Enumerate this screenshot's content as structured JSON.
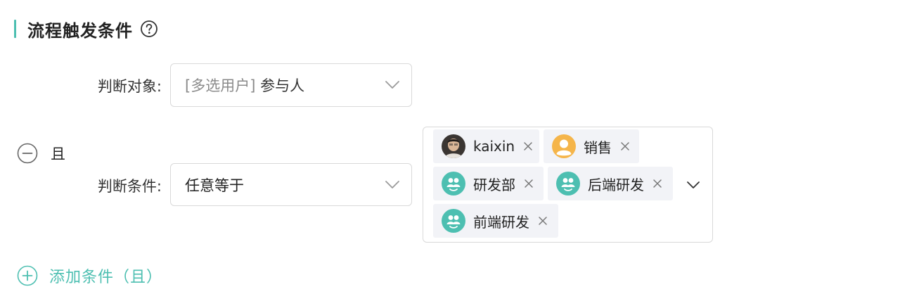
{
  "section": {
    "title": "流程触发条件"
  },
  "judge_object": {
    "label": "判断对象:",
    "value_prefix": "[多选用户]",
    "value_main": "参与人"
  },
  "group": {
    "connector": "且"
  },
  "judge_condition": {
    "label": "判断条件:",
    "value": "任意等于"
  },
  "selected_values": [
    {
      "label": "kaixin",
      "avatar": "user-photo"
    },
    {
      "label": "销售",
      "avatar": "default-user-orange"
    },
    {
      "label": "研发部",
      "avatar": "department-teal"
    },
    {
      "label": "后端研发",
      "avatar": "department-teal"
    },
    {
      "label": "前端研发",
      "avatar": "department-teal"
    }
  ],
  "add_condition": {
    "label": "添加条件（且）"
  },
  "colors": {
    "accent": "#4dbfb1",
    "tag_bg": "#f2f3f7",
    "border": "#d9d9d9",
    "avatar_orange": "#f5b54a"
  }
}
